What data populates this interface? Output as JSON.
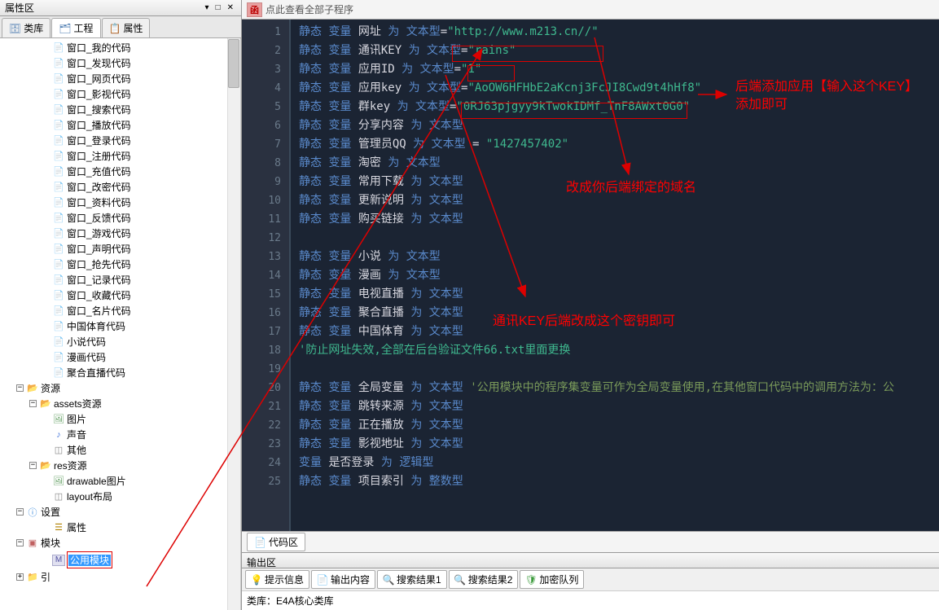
{
  "left_panel": {
    "title": "属性区",
    "controls": [
      "▾",
      "□",
      "✕"
    ],
    "tabs": [
      {
        "icon": "db",
        "label": "类库"
      },
      {
        "icon": "proj",
        "label": "工程"
      },
      {
        "icon": "prop",
        "label": "属性"
      }
    ],
    "tree": [
      {
        "indent": 3,
        "icon": "form",
        "label": "窗口_我的代码"
      },
      {
        "indent": 3,
        "icon": "form",
        "label": "窗口_发现代码"
      },
      {
        "indent": 3,
        "icon": "form",
        "label": "窗口_网页代码"
      },
      {
        "indent": 3,
        "icon": "form",
        "label": "窗口_影视代码"
      },
      {
        "indent": 3,
        "icon": "form",
        "label": "窗口_搜索代码"
      },
      {
        "indent": 3,
        "icon": "form",
        "label": "窗口_播放代码"
      },
      {
        "indent": 3,
        "icon": "form",
        "label": "窗口_登录代码"
      },
      {
        "indent": 3,
        "icon": "form",
        "label": "窗口_注册代码"
      },
      {
        "indent": 3,
        "icon": "form",
        "label": "窗口_充值代码"
      },
      {
        "indent": 3,
        "icon": "form",
        "label": "窗口_改密代码"
      },
      {
        "indent": 3,
        "icon": "form",
        "label": "窗口_资料代码"
      },
      {
        "indent": 3,
        "icon": "form",
        "label": "窗口_反馈代码"
      },
      {
        "indent": 3,
        "icon": "form",
        "label": "窗口_游戏代码"
      },
      {
        "indent": 3,
        "icon": "form",
        "label": "窗口_声明代码"
      },
      {
        "indent": 3,
        "icon": "form",
        "label": "窗口_抢先代码"
      },
      {
        "indent": 3,
        "icon": "form",
        "label": "窗口_记录代码"
      },
      {
        "indent": 3,
        "icon": "form",
        "label": "窗口_收藏代码"
      },
      {
        "indent": 3,
        "icon": "form",
        "label": "窗口_名片代码"
      },
      {
        "indent": 3,
        "icon": "form",
        "label": "中国体育代码"
      },
      {
        "indent": 3,
        "icon": "form",
        "label": "小说代码"
      },
      {
        "indent": 3,
        "icon": "form",
        "label": "漫画代码"
      },
      {
        "indent": 3,
        "icon": "form",
        "label": "聚合直播代码"
      },
      {
        "indent": 1,
        "toggle": "-",
        "icon": "folder-open",
        "label": "资源"
      },
      {
        "indent": 2,
        "toggle": "-",
        "icon": "folder-open",
        "label": "assets资源"
      },
      {
        "indent": 3,
        "icon": "img",
        "label": "图片"
      },
      {
        "indent": 3,
        "icon": "snd",
        "label": "声音"
      },
      {
        "indent": 3,
        "icon": "xml",
        "label": "其他"
      },
      {
        "indent": 2,
        "toggle": "-",
        "icon": "folder-open",
        "label": "res资源"
      },
      {
        "indent": 3,
        "icon": "img",
        "label": "drawable图片"
      },
      {
        "indent": 3,
        "icon": "xml",
        "label": "layout布局"
      },
      {
        "indent": 1,
        "toggle": "-",
        "icon": "info",
        "label": "设置"
      },
      {
        "indent": 3,
        "icon": "prop",
        "label": "属性"
      },
      {
        "indent": 1,
        "toggle": "-",
        "icon": "mod",
        "label": "模块"
      },
      {
        "indent": 3,
        "icon": "m",
        "label": "公用模块",
        "selected": true,
        "boxed": true
      },
      {
        "indent": 1,
        "toggle": "+",
        "icon": "folder",
        "label": "引"
      }
    ]
  },
  "right_panel": {
    "breadcrumb_icon": "函",
    "breadcrumb": "点此查看全部子程序",
    "code_lines": [
      {
        "n": 1,
        "tokens": [
          [
            "mod",
            "静态 "
          ],
          [
            "mod",
            "变量 "
          ],
          [
            "var",
            "网址 "
          ],
          [
            "as",
            "为 "
          ],
          [
            "type",
            "文本型"
          ],
          [
            "eq",
            "="
          ],
          [
            "str",
            "\"http://www.m213.cn//\""
          ]
        ]
      },
      {
        "n": 2,
        "tokens": [
          [
            "mod",
            "静态 "
          ],
          [
            "mod",
            "变量 "
          ],
          [
            "var",
            "通讯KEY "
          ],
          [
            "as",
            "为 "
          ],
          [
            "type",
            "文本型"
          ],
          [
            "eq",
            "="
          ],
          [
            "str",
            "\"rains\""
          ]
        ]
      },
      {
        "n": 3,
        "tokens": [
          [
            "mod",
            "静态 "
          ],
          [
            "mod",
            "变量 "
          ],
          [
            "var",
            "应用ID "
          ],
          [
            "as",
            "为 "
          ],
          [
            "type",
            "文本型"
          ],
          [
            "eq",
            "="
          ],
          [
            "str",
            "\"1\""
          ]
        ]
      },
      {
        "n": 4,
        "tokens": [
          [
            "mod",
            "静态 "
          ],
          [
            "mod",
            "变量 "
          ],
          [
            "var",
            "应用key "
          ],
          [
            "as",
            "为 "
          ],
          [
            "type",
            "文本型"
          ],
          [
            "eq",
            "="
          ],
          [
            "str",
            "\"AoOW6HFHbE2aKcnj3FcJI8Cwd9t4hHf8\""
          ]
        ]
      },
      {
        "n": 5,
        "tokens": [
          [
            "mod",
            "静态 "
          ],
          [
            "mod",
            "变量 "
          ],
          [
            "var",
            "群key "
          ],
          [
            "as",
            "为 "
          ],
          [
            "type",
            "文本型"
          ],
          [
            "eq",
            "="
          ],
          [
            "str",
            "\"0RJ63pjgyy9kTwokIDMf_TnF8AWxt0G0\""
          ]
        ]
      },
      {
        "n": 6,
        "tokens": [
          [
            "mod",
            "静态 "
          ],
          [
            "mod",
            "变量 "
          ],
          [
            "var",
            "分享内容 "
          ],
          [
            "as",
            "为 "
          ],
          [
            "type",
            "文本型"
          ]
        ]
      },
      {
        "n": 7,
        "tokens": [
          [
            "mod",
            "静态 "
          ],
          [
            "mod",
            "变量 "
          ],
          [
            "var",
            "管理员QQ "
          ],
          [
            "as",
            "为 "
          ],
          [
            "type",
            "文本型"
          ],
          [
            "var",
            "    = "
          ],
          [
            "str",
            "\"1427457402\""
          ]
        ]
      },
      {
        "n": 8,
        "tokens": [
          [
            "mod",
            "静态 "
          ],
          [
            "mod",
            "变量 "
          ],
          [
            "var",
            "淘密 "
          ],
          [
            "as",
            "为 "
          ],
          [
            "type",
            "文本型"
          ]
        ]
      },
      {
        "n": 9,
        "tokens": [
          [
            "mod",
            "静态 "
          ],
          [
            "mod",
            "变量 "
          ],
          [
            "var",
            "常用下载 "
          ],
          [
            "as",
            "为 "
          ],
          [
            "type",
            "文本型"
          ]
        ]
      },
      {
        "n": 10,
        "tokens": [
          [
            "mod",
            "静态 "
          ],
          [
            "mod",
            "变量 "
          ],
          [
            "var",
            "更新说明 "
          ],
          [
            "as",
            "为 "
          ],
          [
            "type",
            "文本型"
          ]
        ]
      },
      {
        "n": 11,
        "tokens": [
          [
            "mod",
            "静态 "
          ],
          [
            "mod",
            "变量 "
          ],
          [
            "var",
            "购买链接 "
          ],
          [
            "as",
            "为 "
          ],
          [
            "type",
            "文本型"
          ]
        ]
      },
      {
        "n": 12,
        "tokens": []
      },
      {
        "n": 13,
        "tokens": [
          [
            "mod",
            "静态 "
          ],
          [
            "mod",
            "变量 "
          ],
          [
            "var",
            "小说 "
          ],
          [
            "as",
            "为 "
          ],
          [
            "type",
            "文本型"
          ]
        ]
      },
      {
        "n": 14,
        "tokens": [
          [
            "mod",
            "静态 "
          ],
          [
            "mod",
            "变量 "
          ],
          [
            "var",
            "漫画 "
          ],
          [
            "as",
            "为 "
          ],
          [
            "type",
            "文本型"
          ]
        ]
      },
      {
        "n": 15,
        "tokens": [
          [
            "mod",
            "静态 "
          ],
          [
            "mod",
            "变量 "
          ],
          [
            "var",
            "电视直播 "
          ],
          [
            "as",
            "为 "
          ],
          [
            "type",
            "文本型"
          ]
        ]
      },
      {
        "n": 16,
        "tokens": [
          [
            "mod",
            "静态 "
          ],
          [
            "mod",
            "变量 "
          ],
          [
            "var",
            "聚合直播 "
          ],
          [
            "as",
            "为 "
          ],
          [
            "type",
            "文本型"
          ]
        ]
      },
      {
        "n": 17,
        "tokens": [
          [
            "mod",
            "静态 "
          ],
          [
            "mod",
            "变量 "
          ],
          [
            "var",
            "中国体育 "
          ],
          [
            "as",
            "为 "
          ],
          [
            "type",
            "文本型"
          ]
        ]
      },
      {
        "n": 18,
        "tokens": [
          [
            "comment",
            "'防止网址失效,全部在后台验证文件66.txt里面更换"
          ]
        ]
      },
      {
        "n": 19,
        "tokens": []
      },
      {
        "n": 20,
        "tokens": [
          [
            "mod",
            "静态 "
          ],
          [
            "mod",
            "变量 "
          ],
          [
            "var",
            "全局变量 "
          ],
          [
            "as",
            "为 "
          ],
          [
            "type",
            "文本型 "
          ],
          [
            "comment2",
            "'公用模块中的程序集变量可作为全局变量使用,在其他窗口代码中的调用方法为：公"
          ]
        ]
      },
      {
        "n": 21,
        "tokens": [
          [
            "mod",
            "静态 "
          ],
          [
            "mod",
            "变量 "
          ],
          [
            "var",
            "跳转来源 "
          ],
          [
            "as",
            "为 "
          ],
          [
            "type",
            "文本型"
          ]
        ]
      },
      {
        "n": 22,
        "tokens": [
          [
            "mod",
            "静态 "
          ],
          [
            "mod",
            "变量 "
          ],
          [
            "var",
            "正在播放 "
          ],
          [
            "as",
            "为 "
          ],
          [
            "type",
            "文本型"
          ]
        ]
      },
      {
        "n": 23,
        "tokens": [
          [
            "mod",
            "静态 "
          ],
          [
            "mod",
            "变量 "
          ],
          [
            "var",
            "影视地址 "
          ],
          [
            "as",
            "为 "
          ],
          [
            "type",
            "文本型"
          ]
        ]
      },
      {
        "n": 24,
        "tokens": [
          [
            "mod",
            "     "
          ],
          [
            "mod",
            "变量 "
          ],
          [
            "var",
            "是否登录   "
          ],
          [
            "as",
            "为 "
          ],
          [
            "type",
            "逻辑型"
          ]
        ]
      },
      {
        "n": 25,
        "tokens": [
          [
            "mod",
            "静态 "
          ],
          [
            "mod",
            "变量 "
          ],
          [
            "var",
            "项目索引 "
          ],
          [
            "as",
            "为 "
          ],
          [
            "type",
            "整数型"
          ]
        ]
      }
    ],
    "annotations": {
      "domain": "改成你后端绑定的域名",
      "key": "通讯KEY后端改成这个密钥即可",
      "app": "后端添加应用【输入这个KEY】添加即可"
    },
    "bottom_tab": "代码区",
    "output_title": "输出区",
    "output_tabs": [
      {
        "icon": "💡",
        "color": "#d08020",
        "label": "提示信息"
      },
      {
        "icon": "📄",
        "color": "#888",
        "label": "输出内容"
      },
      {
        "icon": "🔍",
        "color": "#888",
        "label": "搜索结果1"
      },
      {
        "icon": "🔍",
        "color": "#888",
        "label": "搜索结果2"
      },
      {
        "icon": "🛡",
        "color": "#3a9a3a",
        "label": "加密队列"
      }
    ],
    "output_content": "类库：E4A核心类库"
  }
}
